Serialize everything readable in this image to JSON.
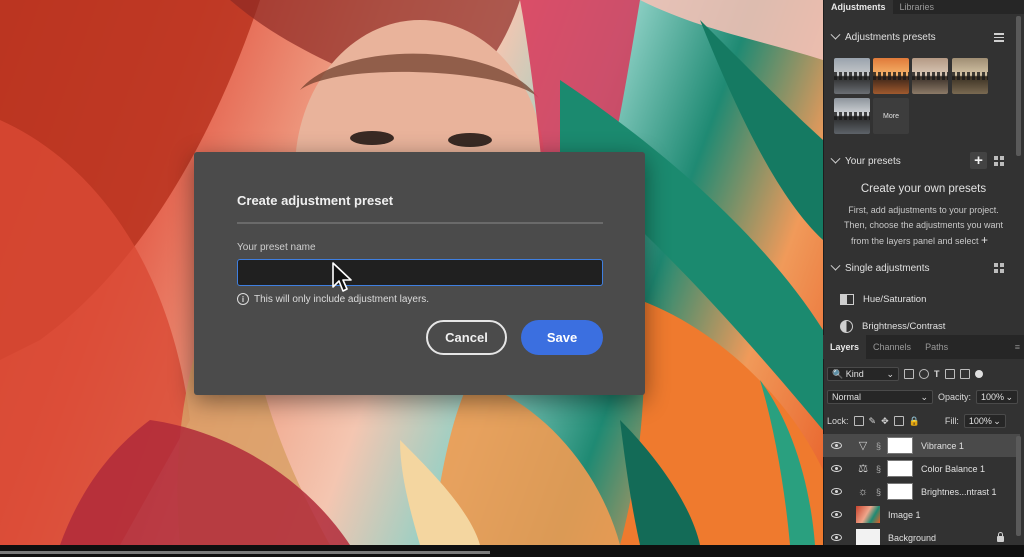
{
  "dialog": {
    "title": "Create adjustment preset",
    "field_label": "Your preset name",
    "name_value": "",
    "info_text": "This will only include adjustment layers.",
    "cancel_label": "Cancel",
    "save_label": "Save",
    "accent_color": "#3b6fe0"
  },
  "panel": {
    "tabs": [
      "Adjustments",
      "Libraries"
    ],
    "presets_header": "Adjustments presets",
    "more_label": "More",
    "your_presets_header": "Your presets",
    "create_title": "Create your own presets",
    "create_desc_1": "First, add adjustments to your project.",
    "create_desc_2": "Then, choose the adjustments you want",
    "create_desc_3": "from the layers panel and select",
    "single_adjustments_header": "Single adjustments",
    "single_adjustments": [
      "Hue/Saturation",
      "Brightness/Contrast"
    ]
  },
  "layers": {
    "tabs": [
      "Layers",
      "Channels",
      "Paths"
    ],
    "filter_kind": "Kind",
    "blend_mode": "Normal",
    "opacity_label": "Opacity:",
    "opacity_value": "100%",
    "lock_label": "Lock:",
    "fill_label": "Fill:",
    "fill_value": "100%",
    "items": [
      {
        "name": "Vibrance 1"
      },
      {
        "name": "Color Balance 1"
      },
      {
        "name": "Brightnes...ntrast 1"
      },
      {
        "name": "Image 1"
      },
      {
        "name": "Background"
      }
    ]
  }
}
